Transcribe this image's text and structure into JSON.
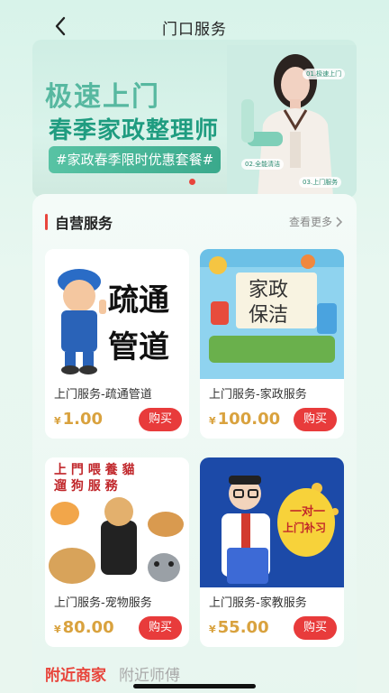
{
  "header": {
    "title": "门口服务"
  },
  "banner": {
    "line1": "极速上门",
    "line2": "春季家政整理师",
    "tag": "#家政春季限时优惠套餐#",
    "chips": [
      "01.极速上门",
      "02.全能清洁",
      "03.上门服务"
    ]
  },
  "section": {
    "title": "自营服务",
    "more": "查看更多"
  },
  "cards": [
    {
      "name": "上门服务-疏通管道",
      "currency": "¥",
      "price": "1.00",
      "buy": "购买",
      "img_text": [
        "疏通",
        "管道"
      ]
    },
    {
      "name": "上门服务-家政服务",
      "currency": "¥",
      "price": "100.00",
      "buy": "购买",
      "img_text": [
        "家政",
        "保洁"
      ]
    },
    {
      "name": "上门服务-宠物服务",
      "currency": "¥",
      "price": "80.00",
      "buy": "购买",
      "img_text": [
        "上 門 喂 養 貓",
        "遛 狗 服 務"
      ]
    },
    {
      "name": "上门服务-家教服务",
      "currency": "¥",
      "price": "55.00",
      "buy": "购买",
      "img_text": [
        "一对一",
        "上门补习"
      ]
    }
  ],
  "tabs": {
    "active": "附近商家",
    "inactive": "附近师傅"
  }
}
